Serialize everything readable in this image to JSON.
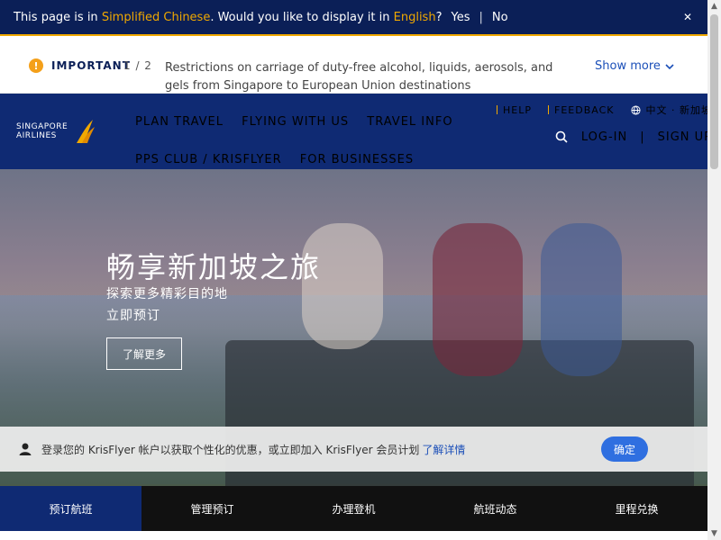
{
  "translate_bar": {
    "prefix": "This page is in",
    "language": "Simplified Chinese",
    "middle": ". Would you like to display it in",
    "target": "English",
    "question": "?",
    "yes": "Yes",
    "separator": "|",
    "no": "No",
    "close": "✕"
  },
  "notice": {
    "icon": "!",
    "label": "IMPORTANT",
    "pager": "1 / 2",
    "text": "Restrictions on carriage of duty-free alcohol, liquids, aerosols, and gels from Singapore to European Union destinations",
    "show_more": "Show more"
  },
  "header": {
    "logo_line1": "SINGAPORE",
    "logo_line2": "AIRLINES",
    "nav_main": [
      "PLAN TRAVEL",
      "FLYING WITH US",
      "TRAVEL INFO"
    ],
    "nav_sub": [
      "PPS CLUB / KRISFLYER",
      "FOR BUSINESSES"
    ],
    "utils": {
      "help": "HELP",
      "feedback": "FEEDBACK",
      "language": "中文 · 新加坡"
    },
    "actions": {
      "login": "LOG-IN",
      "divider": "|",
      "signup": "SIGN UP"
    }
  },
  "hero": {
    "title": "畅享新加坡之旅",
    "subtitle1": "探索更多精彩目的地",
    "subtitle2": "立即预订",
    "button": "了解更多"
  },
  "kf_banner": {
    "text": "登录您的 KrisFlyer 帐户以获取个性化的优惠，或立即加入 KrisFlyer 会员计划",
    "link": "了解详情",
    "ok": "确定"
  },
  "tabs": [
    "预订航班",
    "管理预订",
    "办理登机",
    "航班动态",
    "里程兑换"
  ],
  "colors": {
    "navy": "#0f2a73",
    "accent": "#f0a800",
    "link": "#1b4fb8",
    "button_blue": "#2f6fe0"
  }
}
